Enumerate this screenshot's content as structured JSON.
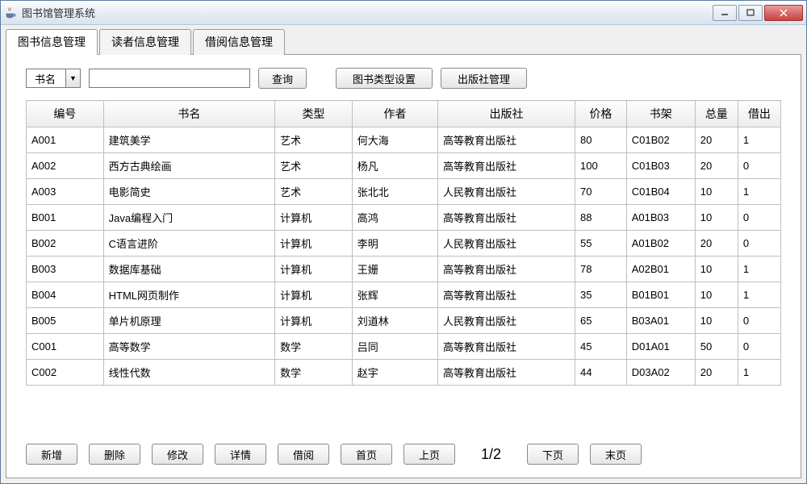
{
  "window": {
    "title": "图书馆管理系统"
  },
  "tabs": [
    {
      "label": "图书信息管理",
      "active": true
    },
    {
      "label": "读者信息管理",
      "active": false
    },
    {
      "label": "借阅信息管理",
      "active": false
    }
  ],
  "search": {
    "field_selected": "书名",
    "input_value": "",
    "query_label": "查询",
    "type_settings_label": "图书类型设置",
    "publisher_mgmt_label": "出版社管理"
  },
  "table": {
    "columns": [
      "编号",
      "书名",
      "类型",
      "作者",
      "出版社",
      "价格",
      "书架",
      "总量",
      "借出"
    ],
    "col_widths": [
      "90",
      "200",
      "90",
      "100",
      "160",
      "60",
      "80",
      "50",
      "50"
    ],
    "rows": [
      {
        "c": [
          "A001",
          "建筑美学",
          "艺术",
          "何大海",
          "高等教育出版社",
          "80",
          "C01B02",
          "20",
          "1"
        ]
      },
      {
        "c": [
          "A002",
          "西方古典绘画",
          "艺术",
          "杨凡",
          "高等教育出版社",
          "100",
          "C01B03",
          "20",
          "0"
        ]
      },
      {
        "c": [
          "A003",
          "电影简史",
          "艺术",
          "张北北",
          "人民教育出版社",
          "70",
          "C01B04",
          "10",
          "1"
        ]
      },
      {
        "c": [
          "B001",
          "Java编程入门",
          "计算机",
          "高鸿",
          "高等教育出版社",
          "88",
          "A01B03",
          "10",
          "0"
        ]
      },
      {
        "c": [
          "B002",
          "C语言进阶",
          "计算机",
          "李明",
          "人民教育出版社",
          "55",
          "A01B02",
          "20",
          "0"
        ]
      },
      {
        "c": [
          "B003",
          "数据库基础",
          "计算机",
          "王姗",
          "高等教育出版社",
          "78",
          "A02B01",
          "10",
          "1"
        ]
      },
      {
        "c": [
          "B004",
          "HTML网页制作",
          "计算机",
          "张辉",
          "高等教育出版社",
          "35",
          "B01B01",
          "10",
          "1"
        ]
      },
      {
        "c": [
          "B005",
          "单片机原理",
          "计算机",
          "刘道林",
          "人民教育出版社",
          "65",
          "B03A01",
          "10",
          "0"
        ]
      },
      {
        "c": [
          "C001",
          "高等数学",
          "数学",
          "吕同",
          "高等教育出版社",
          "45",
          "D01A01",
          "50",
          "0"
        ]
      },
      {
        "c": [
          "C002",
          "线性代数",
          "数学",
          "赵宇",
          "高等教育出版社",
          "44",
          "D03A02",
          "20",
          "1"
        ]
      }
    ]
  },
  "actions": {
    "add": "新增",
    "delete": "删除",
    "edit": "修改",
    "detail": "详情",
    "borrow": "借阅",
    "first": "首页",
    "prev": "上页",
    "next": "下页",
    "last": "末页"
  },
  "pagination": {
    "indicator": "1/2"
  }
}
